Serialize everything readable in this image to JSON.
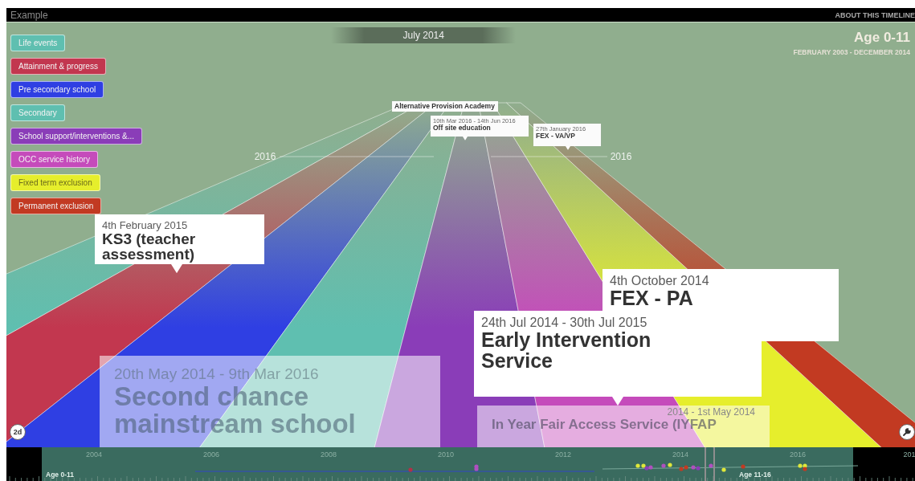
{
  "window": {
    "title": "Example",
    "about_link": "ABOUT THIS TIMELINE"
  },
  "current_date": "July 2014",
  "age_range": {
    "title": "Age 0-11",
    "period": "FEBRUARY 2003 - DECEMBER 2014"
  },
  "legend": [
    {
      "label": "Life events",
      "color": "#5fbfb0"
    },
    {
      "label": "Attainment & progress",
      "color": "#c2374f"
    },
    {
      "label": "Pre secondary school",
      "color": "#2f3fe3"
    },
    {
      "label": "Secondary",
      "color": "#5fbfb0"
    },
    {
      "label": "School support/interventions &...",
      "color": "#8a3db8"
    },
    {
      "label": "OCC service history",
      "color": "#c54bbb"
    },
    {
      "label": "Fixed term exclusion",
      "color": "#e6ee2c"
    },
    {
      "label": "Permanent exclusion",
      "color": "#c23a22"
    }
  ],
  "horizon_labels": [
    "2016",
    "2016"
  ],
  "events": [
    {
      "kind": "far",
      "title": "Alternative Provision Academy"
    },
    {
      "kind": "far",
      "date": "10th Mar 2016 - 14th Jun 2016",
      "title": "Off site education"
    },
    {
      "kind": "far",
      "date": "27th January 2016",
      "title": "FEX - VA/VP"
    },
    {
      "kind": "near",
      "date": "4th February 2015",
      "title": "KS3 (teacher assessment)"
    },
    {
      "kind": "faded",
      "date": "20th May 2014 - 9th Mar 2016",
      "title": "Second chance mainstream school"
    },
    {
      "kind": "near",
      "date": "4th October 2014",
      "title": "FEX - PA"
    },
    {
      "kind": "near",
      "date": "24th Jul 2014 - 30th Jul 2015",
      "title": "Early Intervention Service"
    },
    {
      "kind": "faded",
      "date": "2014 - 1st May 2014",
      "title": "In Year Fair Access Service (IYFAP"
    }
  ],
  "view_toggle": "2d",
  "scrubber": {
    "years": [
      "2004",
      "2006",
      "2008",
      "2010",
      "2012",
      "2014",
      "2016",
      "201"
    ],
    "start_label": "Age 0-11",
    "end_label": "Age 11-16"
  }
}
